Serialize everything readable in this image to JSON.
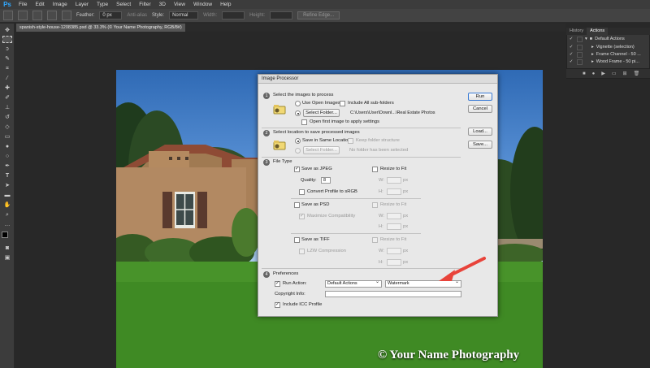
{
  "app": {
    "logo": "Ps"
  },
  "menu": [
    "File",
    "Edit",
    "Image",
    "Layer",
    "Type",
    "Select",
    "Filter",
    "3D",
    "View",
    "Window",
    "Help"
  ],
  "options": {
    "feather_label": "Feather:",
    "feather_value": "0 px",
    "anti_alias_label": "Anti-alias",
    "style_label": "Style:",
    "style_value": "Normal",
    "width_label": "Width:",
    "height_label": "Height:",
    "refine_label": "Refine Edge..."
  },
  "document_tab": "spanish-style-house-1208385.psd @ 33.3% (© Your Name Photography, RGB/8#)",
  "panel": {
    "tabs": [
      "History",
      "Actions"
    ],
    "actions": [
      {
        "name": "Default Actions",
        "kind": "set"
      },
      {
        "name": "Vignette (selection)",
        "kind": "action"
      },
      {
        "name": "Frame Channel - 50 ...",
        "kind": "action"
      },
      {
        "name": "Wood Frame - 50 pi...",
        "kind": "action"
      }
    ]
  },
  "watermark": "© Your Name Photography",
  "dialog": {
    "title": "Image Processor",
    "buttons": {
      "run": "Run",
      "cancel": "Cancel",
      "load": "Load...",
      "save": "Save..."
    },
    "s1": {
      "num": "1",
      "title": "Select the images to process",
      "use_open": "Use Open Images",
      "include_sub": "Include All sub-folders",
      "select_folder": "Select Folder...",
      "path": "C:\\Users\\User\\Downl...\\Real Estate Photos",
      "open_first": "Open first image to apply settings"
    },
    "s2": {
      "num": "2",
      "title": "Select location to save processed images",
      "same_location": "Save in Same Location",
      "keep_structure": "Keep folder structure",
      "select_folder": "Select Folder...",
      "no_folder": "No folder has been selected"
    },
    "s3": {
      "num": "3",
      "title": "File Type",
      "save_jpeg": "Save as JPEG",
      "resize_fit": "Resize to Fit",
      "quality_label": "Quality:",
      "quality_value": "8",
      "w_label": "W:",
      "h_label": "H:",
      "px": "px",
      "convert_srgb": "Convert Profile to sRGB",
      "save_psd": "Save as PSD",
      "maximize": "Maximize Compatibility",
      "save_tiff": "Save as TIFF",
      "lzw": "LZW Compression"
    },
    "s4": {
      "num": "4",
      "title": "Preferences",
      "run_action": "Run Action:",
      "action_set": "Default Actions",
      "action_name": "Watermark",
      "copyright": "Copyright Info:",
      "icc": "Include ICC Profile"
    }
  },
  "colors": {
    "arrow": "#e8433a",
    "accent": "#31a8ff"
  }
}
